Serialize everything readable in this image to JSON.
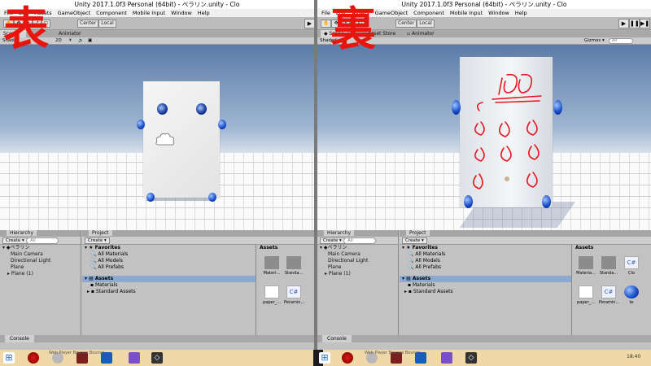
{
  "window": {
    "title": "Unity 2017.1.0f3 Personal (64bit) - ペラリン.unity - Clo"
  },
  "left_label": "表",
  "right_label": "裏",
  "menu": [
    "File",
    "Edit",
    "Assets",
    "GameObject",
    "Component",
    "Mobile Input",
    "Window",
    "Help"
  ],
  "toolbar": {
    "center": "Center",
    "local": "Local"
  },
  "tabs": {
    "scene": "Scene",
    "asset_store": "Asset Store",
    "animator": "Animator"
  },
  "scenebar": {
    "shaded": "Shaded",
    "mode_2d": "2D",
    "gizmos": "Gizmos ▾",
    "search": "All"
  },
  "hierarchy": {
    "tab": "Hierarchy",
    "create": "Create ▾",
    "search": "All",
    "root": "ペラリン",
    "items": [
      "Main Camera",
      "Directional Light",
      "Plane",
      "Plane (1)"
    ]
  },
  "project": {
    "tab": "Project",
    "create": "Create ▾",
    "favorites": "Favorites",
    "fav_items": [
      "All Materials",
      "All Models",
      "All Prefabs"
    ],
    "assets": "Assets",
    "asset_folders": [
      "Materials",
      "Standard Assets"
    ],
    "assets_header": "Assets",
    "tiles_left": [
      "Materi...",
      "Standa...",
      "paper_...",
      "Peramin..."
    ],
    "tiles_right": [
      "Materia...",
      "Standa...",
      "Clo",
      "paper_...",
      "Peramin...",
      "te"
    ]
  },
  "console": {
    "tab": "Console"
  },
  "taskbar": {
    "search_text": "Web Player Bounce Bounce",
    "time_text": "18:40"
  },
  "colors": {
    "accent_red": "#e8140e",
    "sphere_blue": "#1448c8",
    "sky": "#5b7ca8",
    "taskbar": "#f0d8a8"
  }
}
